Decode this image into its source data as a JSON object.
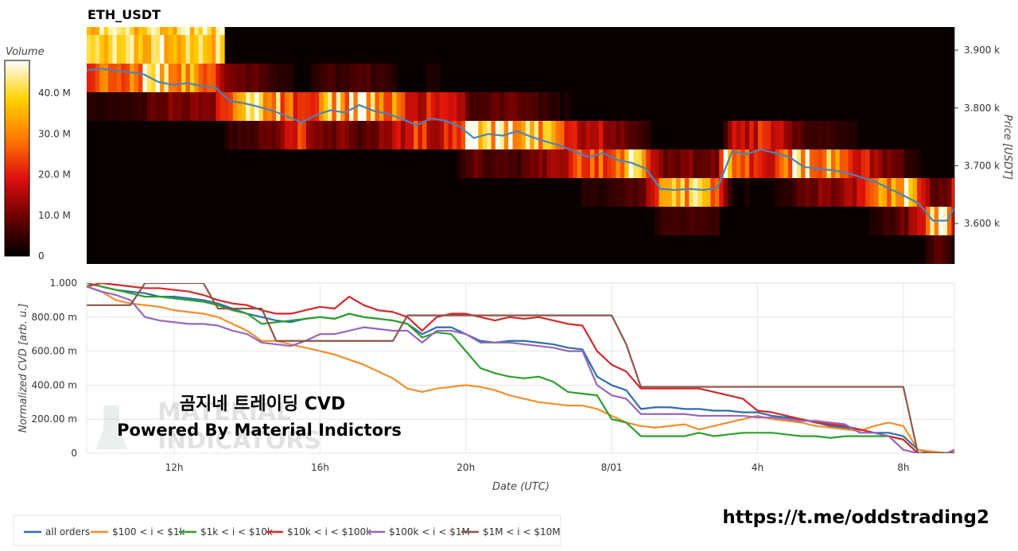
{
  "chart_data": [
    {
      "type": "heatmap",
      "title": "ETH_USDT",
      "colorbar": {
        "label": "Volume",
        "ticks": [
          "0",
          "10.0 M",
          "20.0 M",
          "30.0 M",
          "40.0 M"
        ],
        "tick_values": [
          0,
          10,
          20,
          30,
          40
        ],
        "range": [
          0,
          48
        ]
      },
      "ylabel": "Price [USDT]",
      "y_ticks": [
        {
          "label": "3.900 k",
          "value": 3900
        },
        {
          "label": "3.800 k",
          "value": 3800
        },
        {
          "label": "3.700 k",
          "value": 3700
        },
        {
          "label": "3.600 k",
          "value": 3600
        }
      ],
      "ylim": [
        3530,
        3940
      ],
      "xlim": [
        9.2,
        33.4
      ],
      "price_series": {
        "x": [
          9.2,
          9.6,
          10.0,
          10.4,
          10.8,
          11.2,
          11.6,
          12.0,
          12.4,
          12.8,
          13.2,
          13.6,
          14.0,
          14.4,
          14.8,
          15.2,
          15.6,
          16.0,
          16.4,
          16.8,
          17.2,
          17.6,
          18.0,
          18.4,
          18.8,
          19.2,
          19.6,
          20.0,
          20.4,
          20.8,
          21.2,
          21.6,
          22.0,
          22.4,
          22.8,
          23.2,
          23.6,
          24.0,
          24.4,
          24.8,
          25.2,
          25.6,
          26.0,
          26.4,
          26.8,
          27.2,
          27.6,
          28.0,
          28.4,
          28.8,
          29.2,
          29.6,
          30.0,
          30.4,
          30.8,
          31.2,
          31.6,
          32.0,
          32.4,
          32.8,
          33.2,
          33.4
        ],
        "y": [
          3865,
          3868,
          3864,
          3862,
          3858,
          3845,
          3840,
          3843,
          3838,
          3835,
          3812,
          3808,
          3802,
          3795,
          3785,
          3775,
          3788,
          3796,
          3792,
          3805,
          3795,
          3790,
          3781,
          3770,
          3782,
          3778,
          3768,
          3748,
          3755,
          3752,
          3760,
          3750,
          3742,
          3735,
          3725,
          3715,
          3722,
          3710,
          3705,
          3695,
          3660,
          3658,
          3660,
          3658,
          3662,
          3725,
          3720,
          3728,
          3722,
          3715,
          3698,
          3695,
          3692,
          3688,
          3680,
          3672,
          3660,
          3648,
          3635,
          3605,
          3605,
          3628
        ]
      }
    },
    {
      "type": "line",
      "xlabel": "Date (UTC)",
      "ylabel": "Normalized CVD [arb. u.]",
      "x_ticks": [
        {
          "label": "12h",
          "value": 12
        },
        {
          "label": "16h",
          "value": 16
        },
        {
          "label": "20h",
          "value": 20
        },
        {
          "label": "8/01",
          "value": 24
        },
        {
          "label": "4h",
          "value": 28
        },
        {
          "label": "8h",
          "value": 32
        }
      ],
      "y_ticks": [
        {
          "label": "0",
          "value": 0
        },
        {
          "label": "200.00 m",
          "value": 0.2
        },
        {
          "label": "400.00 m",
          "value": 0.4
        },
        {
          "label": "600.00 m",
          "value": 0.6
        },
        {
          "label": "800.00 m",
          "value": 0.8
        },
        {
          "label": "1.000",
          "value": 1.0
        }
      ],
      "xlim": [
        9.6,
        33.4
      ],
      "ylim": [
        0,
        1.0
      ],
      "grid": true,
      "legend_position": "bottom-left",
      "x": [
        9.6,
        10.0,
        10.4,
        10.8,
        11.2,
        11.6,
        12.0,
        12.4,
        12.8,
        13.2,
        13.6,
        14.0,
        14.4,
        14.8,
        15.2,
        15.6,
        16.0,
        16.4,
        16.8,
        17.2,
        17.6,
        18.0,
        18.4,
        18.8,
        19.2,
        19.6,
        20.0,
        20.4,
        20.8,
        21.2,
        21.6,
        22.0,
        22.4,
        22.8,
        23.2,
        23.6,
        24.0,
        24.4,
        24.8,
        25.2,
        25.6,
        26.0,
        26.4,
        26.8,
        27.2,
        27.6,
        28.0,
        28.4,
        28.8,
        29.2,
        29.6,
        30.0,
        30.4,
        30.8,
        31.2,
        31.6,
        32.0,
        32.4,
        32.8,
        33.2,
        33.4
      ],
      "series": [
        {
          "name": "all orders",
          "color": "#2f6fa8",
          "values": [
            1.0,
            0.98,
            0.96,
            0.95,
            0.94,
            0.92,
            0.92,
            0.91,
            0.9,
            0.88,
            0.85,
            0.82,
            0.8,
            0.78,
            0.77,
            0.79,
            0.8,
            0.79,
            0.82,
            0.8,
            0.79,
            0.78,
            0.76,
            0.7,
            0.74,
            0.74,
            0.7,
            0.66,
            0.65,
            0.66,
            0.66,
            0.65,
            0.64,
            0.62,
            0.61,
            0.45,
            0.4,
            0.37,
            0.26,
            0.27,
            0.27,
            0.26,
            0.26,
            0.25,
            0.25,
            0.24,
            0.24,
            0.22,
            0.21,
            0.2,
            0.18,
            0.16,
            0.15,
            0.14,
            0.12,
            0.12,
            0.1,
            0.02,
            0.0,
            0.0,
            0.02
          ]
        },
        {
          "name": "$100 < i < $1k",
          "color": "#f28e2b",
          "values": [
            0.98,
            0.95,
            0.9,
            0.88,
            0.87,
            0.86,
            0.84,
            0.83,
            0.82,
            0.8,
            0.76,
            0.72,
            0.66,
            0.66,
            0.64,
            0.62,
            0.6,
            0.58,
            0.55,
            0.52,
            0.48,
            0.44,
            0.38,
            0.36,
            0.38,
            0.39,
            0.4,
            0.39,
            0.37,
            0.34,
            0.32,
            0.3,
            0.29,
            0.28,
            0.28,
            0.26,
            0.22,
            0.18,
            0.16,
            0.15,
            0.16,
            0.17,
            0.14,
            0.16,
            0.18,
            0.2,
            0.22,
            0.2,
            0.19,
            0.18,
            0.16,
            0.15,
            0.14,
            0.13,
            0.16,
            0.18,
            0.16,
            0.02,
            0.01,
            0.0,
            0.01
          ]
        },
        {
          "name": "$1k < i < $10k",
          "color": "#2ca02c",
          "values": [
            1.0,
            0.98,
            0.96,
            0.94,
            0.92,
            0.92,
            0.91,
            0.9,
            0.89,
            0.87,
            0.84,
            0.82,
            0.76,
            0.77,
            0.78,
            0.79,
            0.8,
            0.79,
            0.82,
            0.8,
            0.79,
            0.78,
            0.76,
            0.68,
            0.71,
            0.7,
            0.6,
            0.5,
            0.47,
            0.45,
            0.44,
            0.45,
            0.42,
            0.36,
            0.35,
            0.34,
            0.2,
            0.18,
            0.1,
            0.1,
            0.1,
            0.1,
            0.12,
            0.1,
            0.11,
            0.12,
            0.12,
            0.12,
            0.11,
            0.1,
            0.1,
            0.09,
            0.1,
            0.1,
            0.1,
            0.1,
            0.08,
            0.0,
            0.0,
            0.0,
            0.0
          ]
        },
        {
          "name": "$10k < i < $100k",
          "color": "#d62728",
          "values": [
            0.98,
            1.0,
            0.99,
            0.98,
            0.97,
            0.97,
            0.96,
            0.95,
            0.93,
            0.9,
            0.88,
            0.87,
            0.84,
            0.82,
            0.82,
            0.84,
            0.86,
            0.85,
            0.92,
            0.87,
            0.84,
            0.83,
            0.8,
            0.72,
            0.8,
            0.82,
            0.82,
            0.8,
            0.78,
            0.8,
            0.79,
            0.8,
            0.78,
            0.76,
            0.75,
            0.6,
            0.52,
            0.48,
            0.38,
            0.38,
            0.38,
            0.38,
            0.38,
            0.36,
            0.34,
            0.32,
            0.25,
            0.24,
            0.22,
            0.2,
            0.18,
            0.17,
            0.16,
            0.14,
            0.12,
            0.1,
            0.08,
            0.0,
            0.0,
            0.0,
            0.0
          ]
        },
        {
          "name": "$100k < i < $1M",
          "color": "#9467bd",
          "values": [
            0.98,
            0.95,
            0.93,
            0.9,
            0.8,
            0.78,
            0.77,
            0.76,
            0.76,
            0.75,
            0.72,
            0.7,
            0.65,
            0.64,
            0.63,
            0.66,
            0.7,
            0.7,
            0.72,
            0.74,
            0.73,
            0.72,
            0.72,
            0.65,
            0.72,
            0.72,
            0.7,
            0.65,
            0.65,
            0.65,
            0.64,
            0.63,
            0.62,
            0.6,
            0.6,
            0.4,
            0.34,
            0.32,
            0.23,
            0.23,
            0.23,
            0.23,
            0.22,
            0.22,
            0.22,
            0.22,
            0.21,
            0.21,
            0.2,
            0.19,
            0.19,
            0.18,
            0.17,
            0.12,
            0.12,
            0.1,
            0.02,
            0.0,
            0.0,
            0.0,
            0.02
          ]
        },
        {
          "name": "$1M < i < $10M",
          "color": "#8c564b",
          "values": [
            0.87,
            0.87,
            0.87,
            0.87,
            1.0,
            1.0,
            1.0,
            1.0,
            1.0,
            0.85,
            0.85,
            0.85,
            0.85,
            0.66,
            0.66,
            0.66,
            0.66,
            0.66,
            0.66,
            0.66,
            0.66,
            0.66,
            0.81,
            0.81,
            0.81,
            0.81,
            0.81,
            0.81,
            0.81,
            0.81,
            0.81,
            0.81,
            0.81,
            0.81,
            0.81,
            0.81,
            0.81,
            0.64,
            0.39,
            0.39,
            0.39,
            0.39,
            0.39,
            0.39,
            0.39,
            0.39,
            0.39,
            0.39,
            0.39,
            0.39,
            0.39,
            0.39,
            0.39,
            0.39,
            0.39,
            0.39,
            0.39,
            0.0,
            0.0,
            0.0,
            0.0
          ]
        }
      ]
    }
  ],
  "overlay": {
    "korean_title": "곰지네 트레이딩 CVD",
    "powered_by": "Powered By Material Indictors",
    "link": "https://t.me/oddstrading2"
  }
}
